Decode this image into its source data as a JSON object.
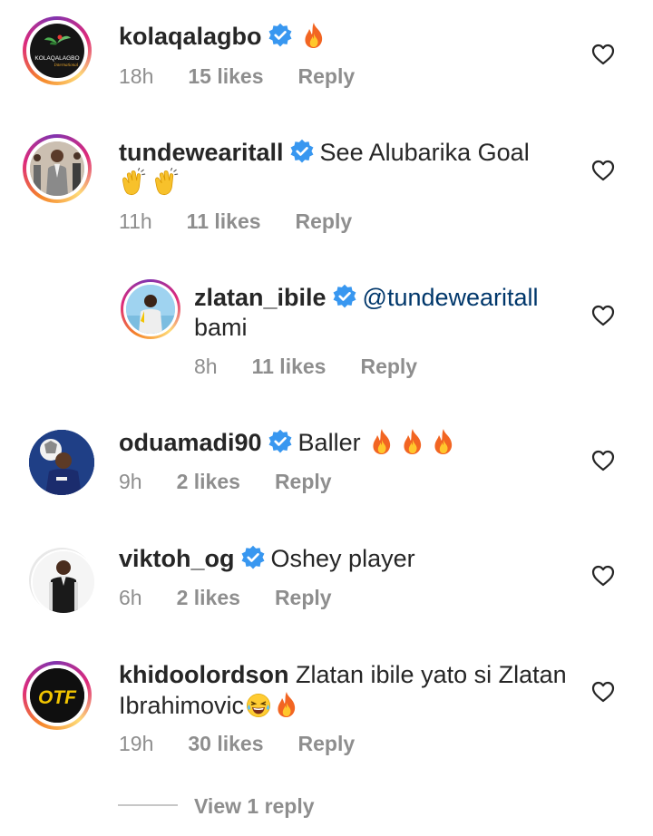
{
  "comments": [
    {
      "username": "kolaqalagbo",
      "text": "",
      "fire_count": 1,
      "time": "18h",
      "likes": "15 likes",
      "reply": "Reply",
      "avatar_text": "KOLAQALAGBO",
      "avatar_subtext": "International"
    },
    {
      "username": "tundewearitall",
      "text": "See Alubarika Goal",
      "text_line2": "",
      "time": "11h",
      "likes": "11 likes",
      "reply": "Reply"
    },
    {
      "username": "zlatan_ibile",
      "mention": "@tundewearitall",
      "text_line2": "bami",
      "time": "8h",
      "likes": "11 likes",
      "reply": "Reply"
    },
    {
      "username": "oduamadi90",
      "text": "Baller",
      "fire_count": 3,
      "time": "9h",
      "likes": "2 likes",
      "reply": "Reply"
    },
    {
      "username": "viktoh_og",
      "text": "Oshey player",
      "time": "6h",
      "likes": "2 likes",
      "reply": "Reply"
    },
    {
      "username": "khidoolordson",
      "text": "Zlatan ibile yato si Zlatan",
      "text_line2": "Ibrahimovic",
      "time": "19h",
      "likes": "30 likes",
      "reply": "Reply",
      "avatar_text": "OTF"
    }
  ],
  "view_replies": "View 1 reply",
  "colors": {
    "text": "#262626",
    "meta": "#8e8e8e",
    "mention": "#00376b",
    "verified": "#3897f0"
  },
  "icons": [
    "verified-badge-icon",
    "fire-emoji-icon",
    "clap-emoji-icon",
    "laughing-emoji-icon",
    "heart-outline-icon"
  ]
}
